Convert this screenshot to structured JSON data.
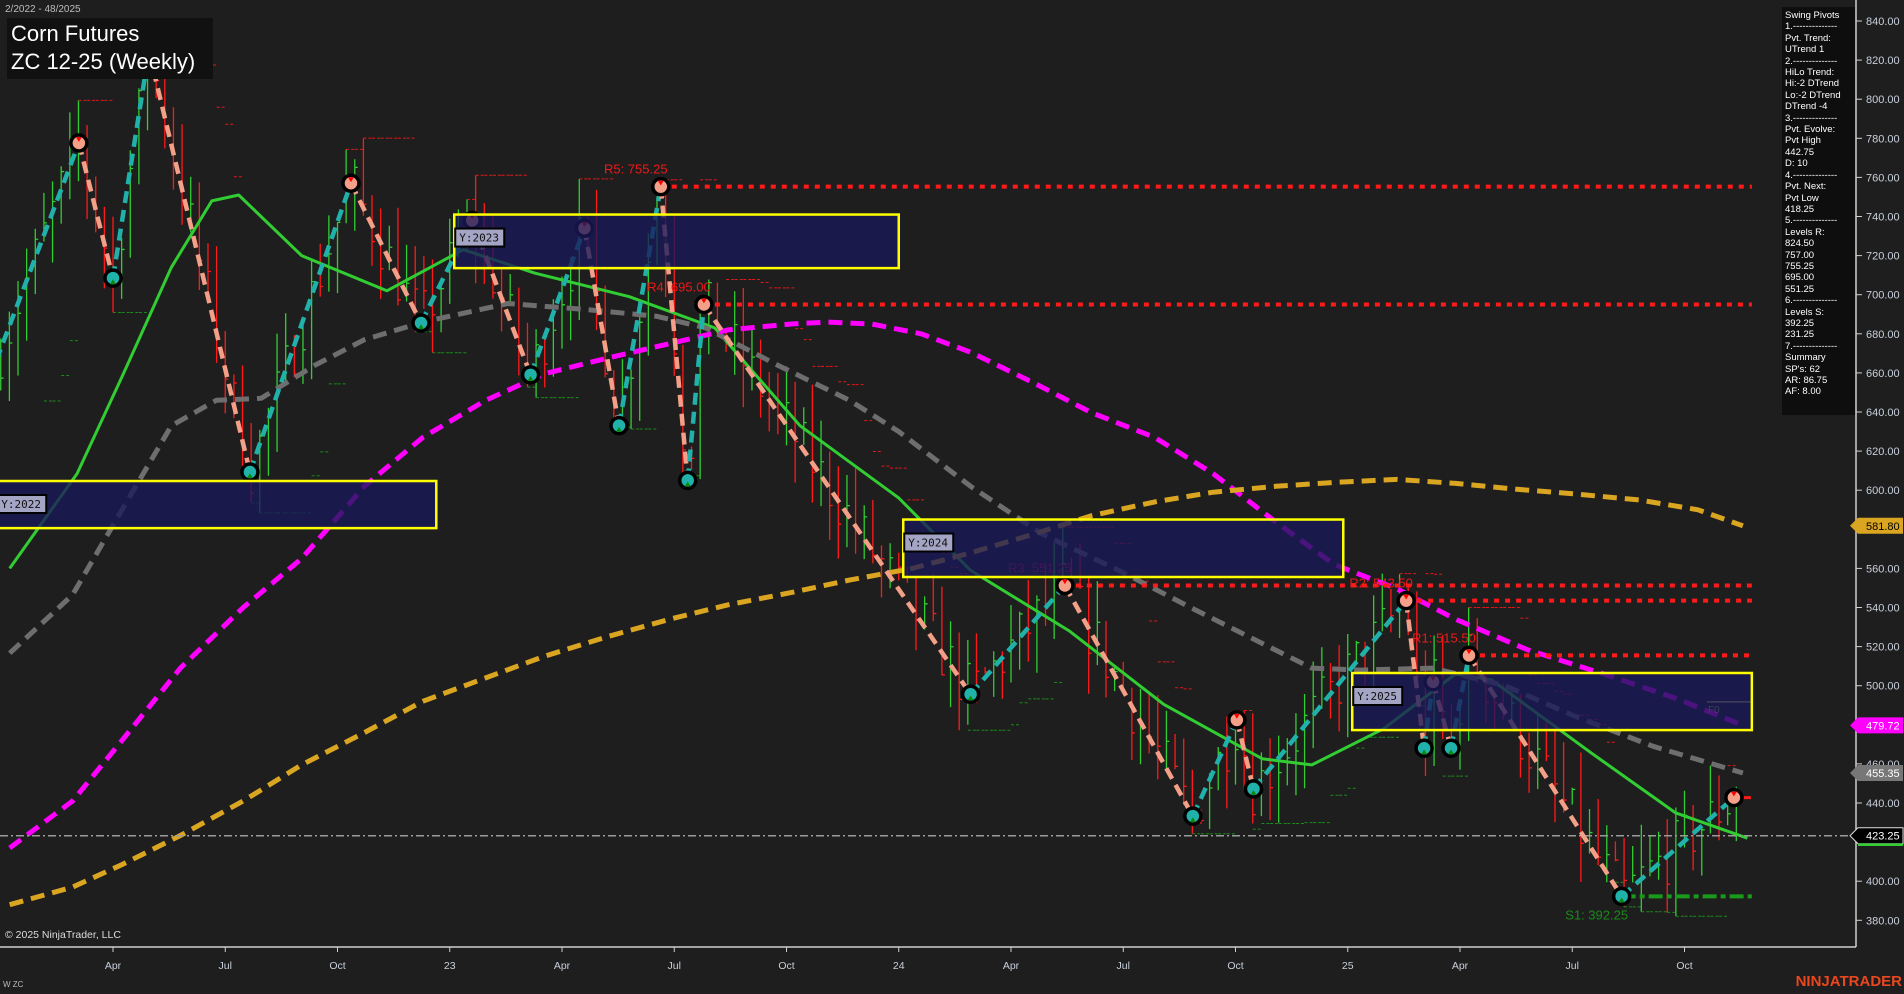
{
  "header": {
    "date_range": "2/2022 - 48/2025",
    "title_line1": "Corn Futures",
    "title_line2": "ZC 12-25 (Weekly)"
  },
  "footer": {
    "copyright": "© 2025 NinjaTrader, LLC",
    "instrument": "W ZC",
    "logo": "NINJATRADER"
  },
  "info_panel": [
    "Swing Pivots",
    "1.--------------",
    "Pvt. Trend:",
    "UTrend 1",
    "2.--------------",
    "HiLo Trend:",
    "Hi:-2 DTrend",
    "Lo:-2 DTrend",
    "DTrend -4",
    "3.--------------",
    "Pvt. Evolve:",
    "Pvt High",
    "442.75",
    "D: 10",
    "4.--------------",
    "Pvt. Next:",
    "Pvt Low",
    "418.25",
    "5.--------------",
    "Levels R:",
    "824.50",
    "757.00",
    "755.25",
    "695.00",
    "551.25",
    "6.--------------",
    "Levels S:",
    "392.25",
    "231.25",
    "7.--------------",
    "Summary",
    "SP's: 62",
    "AR: 86.75",
    "AF: 8.00"
  ],
  "chart_data": {
    "type": "line",
    "title": "Corn Futures ZC 12-25 (Weekly)",
    "xlabel": "",
    "ylabel": "",
    "xlim": [
      2021.98,
      2026.05
    ],
    "ylim": [
      370,
      850
    ],
    "grid": false,
    "y_ticks": [
      "840.00",
      "820.00",
      "800.00",
      "780.00",
      "760.00",
      "740.00",
      "720.00",
      "700.00",
      "680.00",
      "660.00",
      "640.00",
      "620.00",
      "600.00",
      "580.00",
      "560.00",
      "540.00",
      "520.00",
      "500.00",
      "480.00",
      "460.00",
      "440.00",
      "420.00",
      "400.00",
      "380.00"
    ],
    "x_ticks": [
      {
        "t": 2022.25,
        "label": "Apr"
      },
      {
        "t": 2022.5,
        "label": "Jul"
      },
      {
        "t": 2022.75,
        "label": "Oct"
      },
      {
        "t": 2023.0,
        "label": "23"
      },
      {
        "t": 2023.25,
        "label": "Apr"
      },
      {
        "t": 2023.5,
        "label": "Jul"
      },
      {
        "t": 2023.75,
        "label": "Oct"
      },
      {
        "t": 2024.0,
        "label": "24"
      },
      {
        "t": 2024.25,
        "label": "Apr"
      },
      {
        "t": 2024.5,
        "label": "Jul"
      },
      {
        "t": 2024.75,
        "label": "Oct"
      },
      {
        "t": 2025.0,
        "label": "25"
      },
      {
        "t": 2025.25,
        "label": "Apr"
      },
      {
        "t": 2025.5,
        "label": "Jul"
      },
      {
        "t": 2025.75,
        "label": "Oct"
      }
    ],
    "price_tags": [
      {
        "value": 581.8,
        "label": "581.80",
        "bg": "#daa520",
        "fg": "#000000"
      },
      {
        "value": 479.72,
        "label": "479.72",
        "bg": "#ff00ff",
        "fg": "#ffffff"
      },
      {
        "value": 455.35,
        "label": "455.35",
        "bg": "#777777",
        "fg": "#ffffff"
      },
      {
        "value": 423.25,
        "label": "423.25",
        "bg": "#000000",
        "fg": "#ffffff"
      }
    ],
    "last_price": 423.25,
    "pivots": [
      {
        "t": 2021.93,
        "p": 630,
        "type": "L"
      },
      {
        "t": 2022.174,
        "p": 777.6,
        "type": "H"
      },
      {
        "t": 2022.25,
        "p": 708.5,
        "type": "L"
      },
      {
        "t": 2022.33,
        "p": 824.5,
        "type": "H"
      },
      {
        "t": 2022.555,
        "p": 609.3,
        "type": "L"
      },
      {
        "t": 2022.78,
        "p": 757.0,
        "type": "H"
      },
      {
        "t": 2022.936,
        "p": 685.5,
        "type": "L"
      },
      {
        "t": 2023.05,
        "p": 738,
        "type": "H"
      },
      {
        "t": 2023.18,
        "p": 659,
        "type": "L"
      },
      {
        "t": 2023.3,
        "p": 734,
        "type": "H"
      },
      {
        "t": 2023.377,
        "p": 633,
        "type": "L"
      },
      {
        "t": 2023.47,
        "p": 755.25,
        "type": "H"
      },
      {
        "t": 2023.53,
        "p": 605,
        "type": "L"
      },
      {
        "t": 2023.566,
        "p": 695.0,
        "type": "H"
      },
      {
        "t": 2024.16,
        "p": 495.6,
        "type": "L"
      },
      {
        "t": 2024.37,
        "p": 551.25,
        "type": "H"
      },
      {
        "t": 2024.655,
        "p": 433.3,
        "type": "L"
      },
      {
        "t": 2024.753,
        "p": 482.5,
        "type": "H"
      },
      {
        "t": 2024.79,
        "p": 447.2,
        "type": "L"
      },
      {
        "t": 2025.13,
        "p": 543.5,
        "type": "H"
      },
      {
        "t": 2025.17,
        "p": 468,
        "type": "L"
      },
      {
        "t": 2025.19,
        "p": 502,
        "type": "H"
      },
      {
        "t": 2025.23,
        "p": 468,
        "type": "L"
      },
      {
        "t": 2025.27,
        "p": 515.5,
        "type": "H"
      },
      {
        "t": 2025.61,
        "p": 392.25,
        "type": "L"
      },
      {
        "t": 2025.86,
        "p": 442.75,
        "type": "H"
      }
    ],
    "levels": [
      {
        "name": "R5",
        "label": "R5: 755.25",
        "value": 755.25,
        "from_t": 2023.47,
        "kind": "R"
      },
      {
        "name": "R4",
        "label": "R4: 695.00",
        "value": 695.0,
        "from_t": 2023.566,
        "kind": "R"
      },
      {
        "name": "R3",
        "label": "R3: 551.25",
        "value": 551.25,
        "from_t": 2024.37,
        "kind": "R"
      },
      {
        "name": "R2",
        "label": "R2: 543.50",
        "value": 543.5,
        "from_t": 2025.13,
        "kind": "R"
      },
      {
        "name": "R1",
        "label": "R1: 515.50",
        "value": 515.5,
        "from_t": 2025.27,
        "kind": "R"
      },
      {
        "name": "S1",
        "label": "S1: 392.25",
        "value": 392.25,
        "from_t": 2025.61,
        "kind": "S"
      }
    ],
    "level_end_t": 2025.9,
    "fib": {
      "label": "F0",
      "value": 491.7,
      "from_t": 2025.8,
      "to_t": 2025.9
    },
    "year_boxes": [
      {
        "label": "Y:2022",
        "t0": 2021.99,
        "t1": 2022.97,
        "high": 604.7,
        "low": 580.6
      },
      {
        "label": "Y:2023",
        "t0": 2023.01,
        "t1": 2024.0,
        "high": 741.0,
        "low": 713.6
      },
      {
        "label": "Y:2024",
        "t0": 2024.01,
        "t1": 2024.99,
        "high": 585.0,
        "low": 555.6
      },
      {
        "label": "Y:2025",
        "t0": 2025.01,
        "t1": 2025.9,
        "high": 506.5,
        "low": 477.3
      }
    ],
    "series": [
      {
        "name": "fast-ma",
        "color": "#32cd32",
        "style": "solid",
        "points": [
          [
            2022.02,
            560
          ],
          [
            2022.17,
            608.5
          ],
          [
            2022.27,
            658
          ],
          [
            2022.38,
            714
          ],
          [
            2022.47,
            748
          ],
          [
            2022.53,
            751
          ],
          [
            2022.67,
            720
          ],
          [
            2022.86,
            702
          ],
          [
            2023.03,
            723
          ],
          [
            2023.19,
            711
          ],
          [
            2023.4,
            699
          ],
          [
            2023.59,
            683
          ],
          [
            2023.78,
            633
          ],
          [
            2024.0,
            596
          ],
          [
            2024.16,
            559
          ],
          [
            2024.38,
            528
          ],
          [
            2024.59,
            490.5
          ],
          [
            2024.81,
            462.6
          ],
          [
            2024.92,
            459.5
          ],
          [
            2025.08,
            478
          ],
          [
            2025.24,
            506
          ],
          [
            2025.32,
            503
          ],
          [
            2025.54,
            466
          ],
          [
            2025.73,
            435
          ],
          [
            2025.89,
            422
          ]
        ]
      },
      {
        "name": "slow-ma",
        "color": "#6e6e6e",
        "style": "dashed",
        "points": [
          [
            2022.02,
            516.6
          ],
          [
            2022.16,
            546.5
          ],
          [
            2022.27,
            590
          ],
          [
            2022.38,
            633
          ],
          [
            2022.48,
            646
          ],
          [
            2022.58,
            647
          ],
          [
            2022.7,
            664
          ],
          [
            2022.81,
            677
          ],
          [
            2022.94,
            686
          ],
          [
            2023.13,
            695.5
          ],
          [
            2023.3,
            692.5
          ],
          [
            2023.46,
            689
          ],
          [
            2023.57,
            683
          ],
          [
            2023.73,
            664
          ],
          [
            2023.89,
            646
          ],
          [
            2024.0,
            630
          ],
          [
            2024.16,
            602
          ],
          [
            2024.32,
            577.5
          ],
          [
            2024.49,
            559
          ],
          [
            2024.65,
            540
          ],
          [
            2024.81,
            521.6
          ],
          [
            2024.92,
            509
          ],
          [
            2025.03,
            508
          ],
          [
            2025.19,
            509
          ],
          [
            2025.35,
            500
          ],
          [
            2025.51,
            484
          ],
          [
            2025.68,
            469
          ],
          [
            2025.88,
            455.35
          ]
        ]
      },
      {
        "name": "magenta-ma",
        "color": "#ff00ff",
        "style": "dashed",
        "points": [
          [
            2022.02,
            417
          ],
          [
            2022.16,
            441
          ],
          [
            2022.27,
            472
          ],
          [
            2022.4,
            509
          ],
          [
            2022.54,
            540
          ],
          [
            2022.67,
            565
          ],
          [
            2022.81,
            602
          ],
          [
            2022.94,
            627
          ],
          [
            2023.08,
            646
          ],
          [
            2023.21,
            659.5
          ],
          [
            2023.35,
            667.5
          ],
          [
            2023.49,
            675
          ],
          [
            2023.62,
            682
          ],
          [
            2023.76,
            685
          ],
          [
            2023.84,
            686
          ],
          [
            2023.94,
            685
          ],
          [
            2024.05,
            680
          ],
          [
            2024.16,
            670.6
          ],
          [
            2024.3,
            655
          ],
          [
            2024.43,
            639.6
          ],
          [
            2024.57,
            627
          ],
          [
            2024.7,
            608.5
          ],
          [
            2024.84,
            583.7
          ],
          [
            2024.97,
            562
          ],
          [
            2025.11,
            549.5
          ],
          [
            2025.24,
            534
          ],
          [
            2025.4,
            518.4
          ],
          [
            2025.57,
            506
          ],
          [
            2025.73,
            493.6
          ],
          [
            2025.88,
            479.72
          ]
        ]
      },
      {
        "name": "orange-ma",
        "color": "#daa520",
        "style": "dashed",
        "points": [
          [
            2022.02,
            388
          ],
          [
            2022.16,
            397
          ],
          [
            2022.27,
            408.5
          ],
          [
            2022.4,
            423.4
          ],
          [
            2022.54,
            441
          ],
          [
            2022.67,
            459.5
          ],
          [
            2022.81,
            476
          ],
          [
            2022.94,
            492
          ],
          [
            2023.08,
            504
          ],
          [
            2023.21,
            515
          ],
          [
            2023.35,
            525
          ],
          [
            2023.49,
            534
          ],
          [
            2023.62,
            541.4
          ],
          [
            2023.76,
            547.6
          ],
          [
            2023.89,
            554
          ],
          [
            2024.03,
            560
          ],
          [
            2024.16,
            568
          ],
          [
            2024.3,
            577.5
          ],
          [
            2024.43,
            587
          ],
          [
            2024.57,
            594
          ],
          [
            2024.7,
            599
          ],
          [
            2024.84,
            602
          ],
          [
            2024.97,
            604
          ],
          [
            2025.11,
            605.5
          ],
          [
            2025.24,
            603.5
          ],
          [
            2025.38,
            600.4
          ],
          [
            2025.51,
            598
          ],
          [
            2025.65,
            595
          ],
          [
            2025.78,
            590
          ],
          [
            2025.88,
            581.8
          ]
        ]
      }
    ]
  },
  "colors": {
    "background": "#1e1e1e",
    "up_bar": "#32cd32",
    "down_bar": "#ff1a1a",
    "pivot_high": "#f4a088",
    "pivot_low": "#20b2aa",
    "resistance": "#ff1a1a",
    "support": "#1a9a1a",
    "box_fill": "#18185a",
    "box_border": "#ffff00"
  }
}
